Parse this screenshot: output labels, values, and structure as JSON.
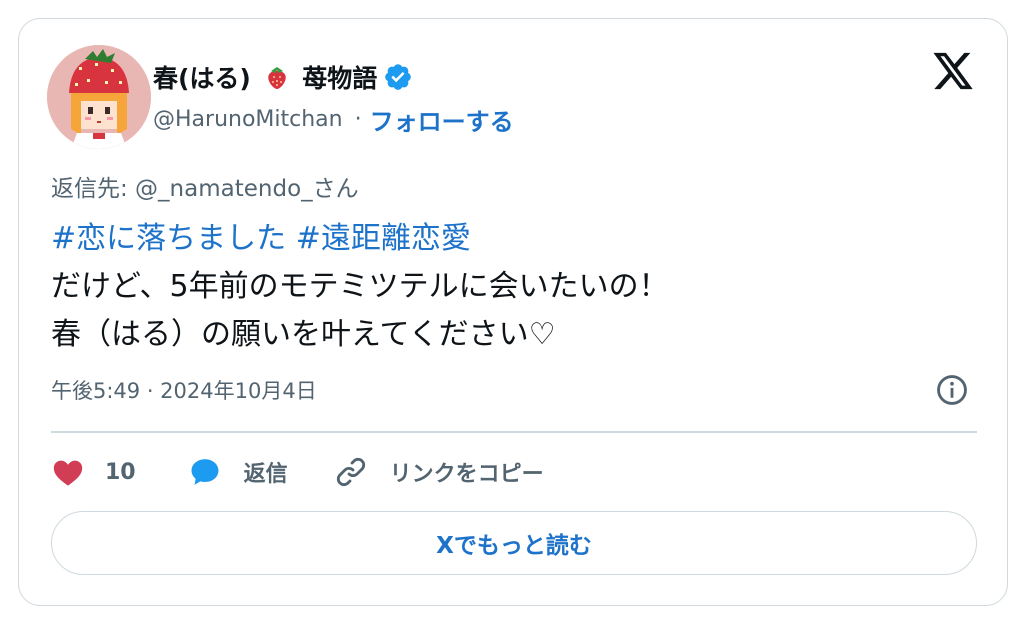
{
  "user": {
    "display_name_prefix": "春(はる)",
    "display_name_suffix": "苺物語",
    "handle": "@HarunoMitchan",
    "separator": "·",
    "follow_label": "フォローする"
  },
  "tweet": {
    "reply_to": "返信先: @_namatendo_さん",
    "hashtag_1": "#恋に落ちました",
    "hashtag_2": "#遠距離恋愛",
    "line_2": "だけど、5年前のモテミツテルに会いたいの！",
    "line_3": "春（はる）の願いを叶えてください♡",
    "timestamp": "午後5:49 · 2024年10月4日"
  },
  "actions": {
    "like_count": "10",
    "reply_label": "返信",
    "copy_link_label": "リンクをコピー"
  },
  "read_more_label": "Xでもっと読む",
  "icons": {
    "verified": "verified-badge-icon",
    "logo": "x-logo-icon",
    "info": "info-icon",
    "like": "heart-icon",
    "reply": "speech-bubble-icon",
    "link": "link-icon",
    "emoji": "strawberry-icon"
  },
  "colors": {
    "link_blue": "#1d72c9",
    "heart_red": "#d13d55",
    "verified_blue": "#1d9bf0",
    "muted_text": "#536471",
    "border": "#cfd9de"
  }
}
